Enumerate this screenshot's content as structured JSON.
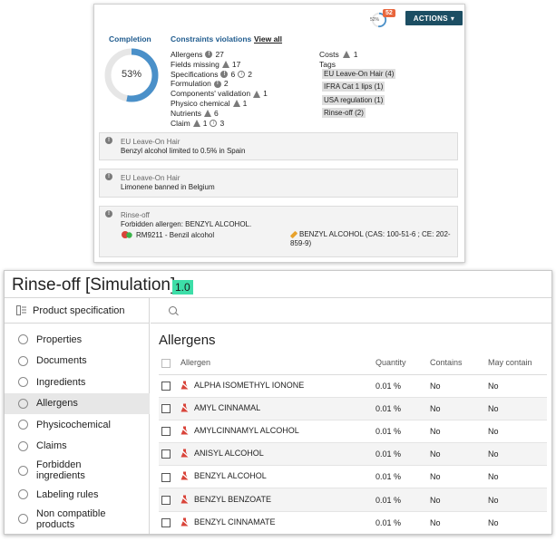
{
  "top_card": {
    "mini_progress_label": "52%",
    "mini_badge_count": "52",
    "actions_label": "ACTIONS",
    "completion": {
      "title": "Completion",
      "percent_label": "53%",
      "percent_value": 53
    },
    "constraints": {
      "title": "Constraints violations",
      "view_all": "View all",
      "items": [
        {
          "label": "Allergens",
          "icons": [
            {
              "kind": "excl",
              "count": "27"
            }
          ]
        },
        {
          "label": "Fields missing",
          "icons": [
            {
              "kind": "warn",
              "count": "17"
            }
          ]
        },
        {
          "label": "Specifications",
          "icons": [
            {
              "kind": "excl",
              "count": "6"
            },
            {
              "kind": "info",
              "count": "2"
            }
          ]
        },
        {
          "label": "Formulation",
          "icons": [
            {
              "kind": "excl",
              "count": "2"
            }
          ]
        },
        {
          "label": "Components' validation",
          "icons": [
            {
              "kind": "warn",
              "count": "1"
            }
          ]
        },
        {
          "label": "Physico chemical",
          "icons": [
            {
              "kind": "warn",
              "count": "1"
            }
          ]
        },
        {
          "label": "Nutrients",
          "icons": [
            {
              "kind": "warn",
              "count": "6"
            }
          ]
        },
        {
          "label": "Claim",
          "icons": [
            {
              "kind": "warn",
              "count": "1"
            },
            {
              "kind": "info",
              "count": "3"
            }
          ]
        }
      ],
      "costs_label": "Costs",
      "costs_count": "1",
      "tags_label": "Tags",
      "tags": [
        "EU Leave-On Hair (4)",
        "IFRA Cat 1 lips (1)",
        "USA regulation (1)",
        "Rinse-off (2)"
      ]
    },
    "violations": [
      {
        "title": "EU Leave-On Hair",
        "text": "Benzyl alcohol limited to 0.5% in Spain"
      },
      {
        "title": "EU Leave-On Hair",
        "text": "Limonene banned in Belgium"
      },
      {
        "title": "Rinse-off",
        "text": "Forbidden allergen: BENZYL ALCOHOL.",
        "raw_material": "RM9211 - Benzil alcohol",
        "allergen_detail": "BENZYL ALCOHOL (CAS: 100-51-6 ; CE: 202-859-9)"
      }
    ]
  },
  "window": {
    "title": "Rinse-off [Simulation]",
    "version": "1.0",
    "sidebar_header": "Product specification",
    "nav": [
      {
        "label": "Properties",
        "selected": false
      },
      {
        "label": "Documents",
        "selected": false
      },
      {
        "label": "Ingredients",
        "selected": false
      },
      {
        "label": "Allergens",
        "selected": true
      },
      {
        "label": "Physicochemical",
        "selected": false
      },
      {
        "label": "Claims",
        "selected": false
      },
      {
        "label": "Forbidden ingredients",
        "selected": false
      },
      {
        "label": "Labeling rules",
        "selected": false
      },
      {
        "label": "Non compatible products",
        "selected": false
      }
    ],
    "search_placeholder": "",
    "section_title": "Allergens",
    "table": {
      "headers": {
        "allergen": "Allergen",
        "quantity": "Quantity",
        "contains": "Contains",
        "may_contain": "May contain"
      },
      "rows": [
        {
          "allergen": "ALPHA ISOMETHYL IONONE",
          "quantity": "0.01 %",
          "contains": "No",
          "may_contain": "No"
        },
        {
          "allergen": "AMYL CINNAMAL",
          "quantity": "0.01 %",
          "contains": "No",
          "may_contain": "No"
        },
        {
          "allergen": "AMYLCINNAMYL ALCOHOL",
          "quantity": "0.01 %",
          "contains": "No",
          "may_contain": "No"
        },
        {
          "allergen": "ANISYL ALCOHOL",
          "quantity": "0.01 %",
          "contains": "No",
          "may_contain": "No"
        },
        {
          "allergen": "BENZYL ALCOHOL",
          "quantity": "0.01 %",
          "contains": "No",
          "may_contain": "No"
        },
        {
          "allergen": "BENZYL BENZOATE",
          "quantity": "0.01 %",
          "contains": "No",
          "may_contain": "No"
        },
        {
          "allergen": "BENZYL CINNAMATE",
          "quantity": "0.01 %",
          "contains": "No",
          "may_contain": "No"
        }
      ]
    }
  },
  "colors": {
    "accent_dark": "#1c4e63",
    "heading_blue": "#1f5b8e",
    "donut_fill": "#4a90c9",
    "donut_track": "#e6e6e6",
    "version_badge": "#3ddea8",
    "allergen_icon": "#d9443a",
    "badge_orange": "#e8663d"
  }
}
